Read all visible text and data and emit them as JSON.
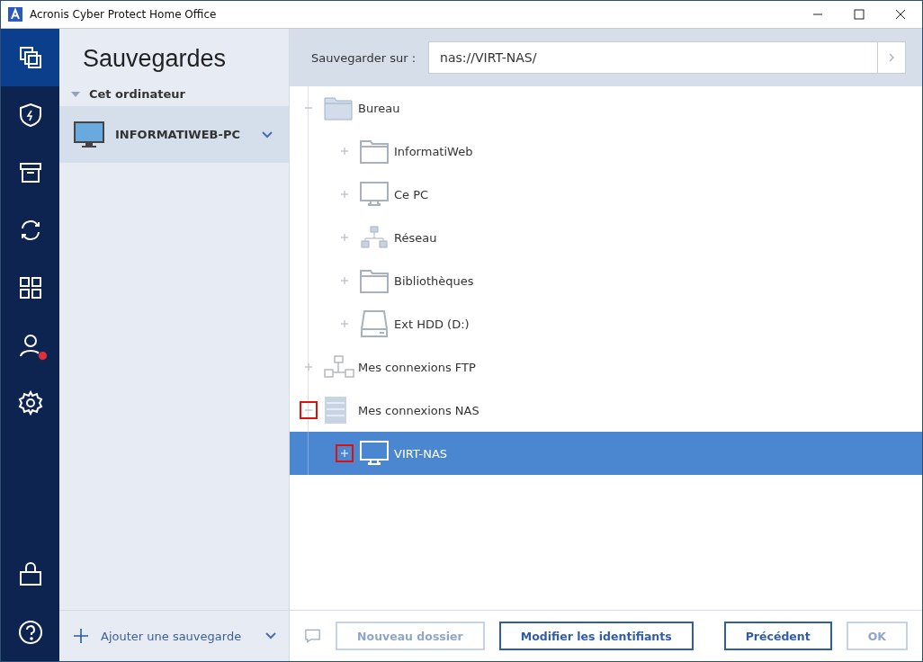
{
  "window": {
    "title": "Acronis Cyber Protect Home Office"
  },
  "nav": [
    {
      "kind": "backup",
      "selected": true,
      "badge": false
    },
    {
      "kind": "protection",
      "selected": false,
      "badge": false
    },
    {
      "kind": "archive",
      "selected": false,
      "badge": false
    },
    {
      "kind": "sync",
      "selected": false,
      "badge": false
    },
    {
      "kind": "tools",
      "selected": false,
      "badge": false
    },
    {
      "kind": "account",
      "selected": false,
      "badge": true
    },
    {
      "kind": "settings",
      "selected": false,
      "badge": false
    }
  ],
  "nav_bottom": [
    {
      "kind": "shop"
    },
    {
      "kind": "help"
    }
  ],
  "sidebar": {
    "title": "Sauvegardes",
    "group": "Cet ordinateur",
    "items": [
      {
        "label": "INFORMATIWEB-PC",
        "selected": true
      }
    ],
    "add_label": "Ajouter une sauvegarde"
  },
  "destination": {
    "label": "Sauvegarder sur :",
    "value": "nas://VIRT-NAS/"
  },
  "tree": [
    {
      "label": "Bureau",
      "kind": "folder",
      "expanded": true,
      "selected": false,
      "highlighted": false,
      "children": [
        {
          "label": "InformatiWeb",
          "kind": "folder-outline",
          "expanded": false,
          "selected": false,
          "highlighted": false
        },
        {
          "label": "Ce PC",
          "kind": "pc",
          "expanded": false,
          "selected": false,
          "highlighted": false
        },
        {
          "label": "Réseau",
          "kind": "network",
          "expanded": false,
          "selected": false,
          "highlighted": false
        },
        {
          "label": "Bibliothèques",
          "kind": "folder-outline",
          "expanded": false,
          "selected": false,
          "highlighted": false
        },
        {
          "label": "Ext HDD (D:)",
          "kind": "drive",
          "expanded": false,
          "selected": false,
          "highlighted": false
        }
      ]
    },
    {
      "label": "Mes connexions FTP",
      "kind": "ftp",
      "expanded": false,
      "selected": false,
      "highlighted": false
    },
    {
      "label": "Mes connexions NAS",
      "kind": "nas",
      "expanded": true,
      "selected": false,
      "highlighted": true,
      "children": [
        {
          "label": "VIRT-NAS",
          "kind": "monitor",
          "expanded": false,
          "selected": true,
          "highlighted": true
        }
      ]
    }
  ],
  "buttons": [
    {
      "label": "Nouveau dossier",
      "disabled": true
    },
    {
      "label": "Modifier les identifiants",
      "disabled": false
    },
    {
      "label": "Précédent",
      "disabled": false
    },
    {
      "label": "OK",
      "disabled": true
    }
  ]
}
